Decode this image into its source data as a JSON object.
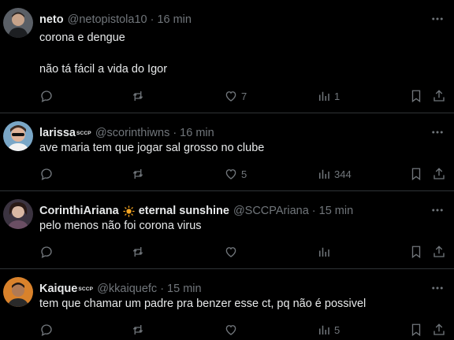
{
  "tweets": [
    {
      "name": "neto",
      "badge": "",
      "handle": "@netopistola10",
      "sep": "·",
      "time": "16 min",
      "lines": [
        "corona e dengue",
        "",
        "não tá fácil a vida do Igor"
      ],
      "replies": "",
      "reposts": "",
      "likes": "7",
      "views": "1"
    },
    {
      "name": "larissa",
      "badge": "SCCP",
      "handle": "@scorinthiwns",
      "sep": "·",
      "time": "16 min",
      "lines": [
        "ave maria tem que jogar sal grosso no clube"
      ],
      "replies": "",
      "reposts": "",
      "likes": "5",
      "views": "344"
    },
    {
      "name": "CorinthiAriana",
      "name_suffix": "eternal sunshine",
      "badge": "",
      "handle": "@SCCPAriana",
      "sep": "·",
      "time": "15 min",
      "lines": [
        "pelo menos não foi corona virus"
      ],
      "replies": "",
      "reposts": "",
      "likes": "",
      "views": ""
    },
    {
      "name": "Kaique",
      "badge": "SCCP",
      "handle": "@kkaiquefc",
      "sep": "·",
      "time": "15 min",
      "lines": [
        "tem que chamar um padre pra benzer esse ct, pq não é possivel"
      ],
      "replies": "",
      "reposts": "",
      "likes": "",
      "views": "5"
    }
  ],
  "icons": {
    "reply": "reply-icon",
    "repost": "repost-icon",
    "like": "heart-icon",
    "views": "views-icon",
    "bookmark": "bookmark-icon",
    "share": "share-icon",
    "more": "more-icon"
  },
  "colors": {
    "background": "#000000",
    "text": "#e7e9ea",
    "muted": "#71767b",
    "divider": "#2f3336",
    "sun": "#f5a623"
  }
}
